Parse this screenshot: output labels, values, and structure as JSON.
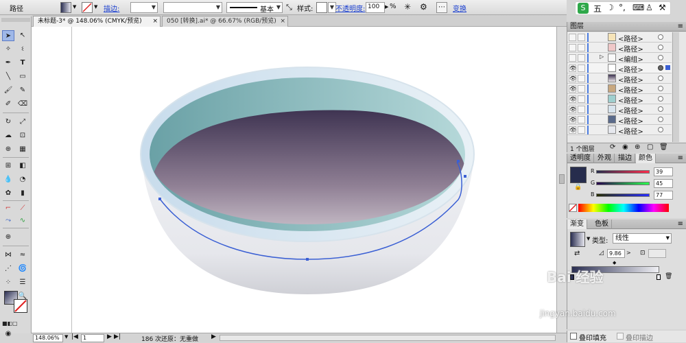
{
  "control_bar": {
    "object_type": "路径",
    "stroke_label": "描边:",
    "stroke_profile": "基本",
    "style_label": "样式:",
    "opacity_label": "不透明度:",
    "opacity_value": "100",
    "percent": "%",
    "transform_label": "变换"
  },
  "ime": {
    "label": "五",
    "items": [
      "五",
      "☽",
      "’",
      "⌨",
      "👕",
      "🔧"
    ]
  },
  "tabs": [
    {
      "label": "未标题-3* @ 148.06% (CMYK/预览)",
      "close": "×"
    },
    {
      "label": "050 [转换].ai* @ 66.67% (RGB/预览)",
      "close": "×"
    }
  ],
  "status_bar": {
    "zoom": "148.06%",
    "page": "1",
    "status_text": "186 次还原：无重做"
  },
  "layers_panel": {
    "title": "图层",
    "rows": [
      {
        "name": "<路径>",
        "visible": false,
        "selected": false
      },
      {
        "name": "<路径>",
        "visible": false,
        "selected": false
      },
      {
        "name": "<编组>",
        "visible": false,
        "selected": false
      },
      {
        "name": "<路径>",
        "visible": true,
        "selected": true
      },
      {
        "name": "<路径>",
        "visible": true,
        "selected": false
      },
      {
        "name": "<路径>",
        "visible": true,
        "selected": false
      },
      {
        "name": "<路径>",
        "visible": true,
        "selected": false
      },
      {
        "name": "<路径>",
        "visible": true,
        "selected": false
      },
      {
        "name": "<路径>",
        "visible": true,
        "selected": false
      },
      {
        "name": "<路径>",
        "visible": true,
        "selected": false
      }
    ],
    "footer": "1 个图层"
  },
  "color_panel": {
    "tabs": [
      "透明度",
      "外观",
      "描边",
      "颜色"
    ],
    "r_label": "R",
    "r_value": "39",
    "g_label": "G",
    "g_value": "45",
    "b_label": "B",
    "b_value": "77",
    "swatch_color": "#272d4d"
  },
  "gradient_panel": {
    "tabs": [
      "渐变",
      "色板"
    ],
    "type_label": "类型:",
    "type_value": "线性",
    "angle_value": "9.86"
  },
  "watermark": "Bai 经验",
  "watermark_url": "jingyan.baidu.com",
  "bottom_panel": {
    "fill_label": "叠印填充",
    "stroke_label": "叠印描边"
  }
}
